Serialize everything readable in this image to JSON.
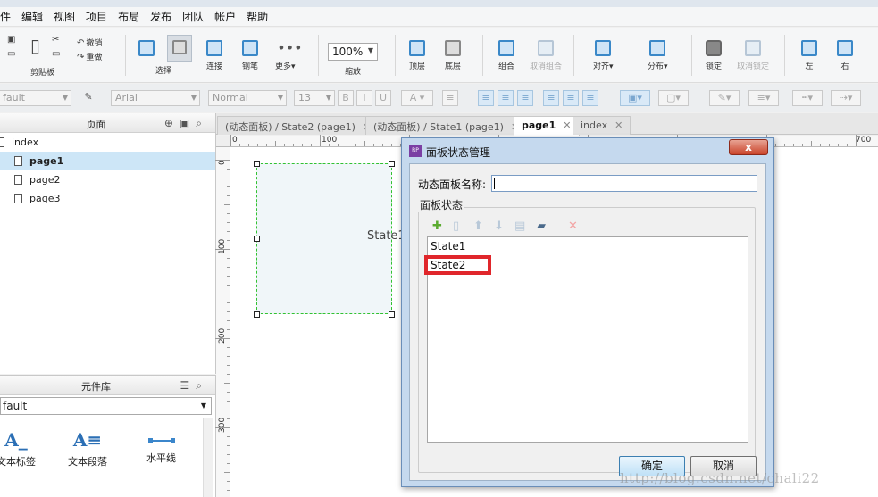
{
  "menubar": {
    "items": [
      "件",
      "编辑",
      "视图",
      "项目",
      "布局",
      "发布",
      "团队",
      "帐户",
      "帮助"
    ]
  },
  "toolbar": {
    "undo": "撤销",
    "redo": "重做",
    "clipboard": "剪贴板",
    "select": "选择",
    "connect": "连接",
    "pen": "钢笔",
    "more": "更多▾",
    "zoom_value": "100%",
    "zoom_label": "缩放",
    "top": "顶层",
    "bottom": "底层",
    "group": "组合",
    "ungroup": "取消组合",
    "align": "对齐▾",
    "distribute": "分布▾",
    "lock": "锁定",
    "unlock": "取消锁定",
    "left": "左",
    "right": "右"
  },
  "formatbar": {
    "style": "fault",
    "font": "Arial",
    "weight": "Normal",
    "size": "13"
  },
  "pages": {
    "title": "页面",
    "items": [
      "index",
      "page1",
      "page2",
      "page3"
    ],
    "selected_index": 1
  },
  "library": {
    "title": "元件库",
    "selected": "fault",
    "widgets": [
      "文本标签",
      "文本段落",
      "水平线"
    ],
    "widget_icons": [
      "A_",
      "A≡"
    ]
  },
  "tabs": [
    {
      "label": "(动态面板) / State2 (page1)"
    },
    {
      "label": "(动态面板) / State1 (page1)"
    },
    {
      "label": "page1"
    },
    {
      "label": "index"
    }
  ],
  "active_tab": 2,
  "ruler": {
    "top": [
      "0",
      "100",
      "700"
    ],
    "left": [
      "0",
      "100",
      "200",
      "300"
    ]
  },
  "canvas": {
    "panel_label": "State1"
  },
  "dialog": {
    "title": "面板状态管理",
    "close_label": "x",
    "name_label": "动态面板名称:",
    "name_value": "",
    "group_label": "面板状态",
    "states": [
      "State1",
      "State2"
    ],
    "ok": "确定",
    "cancel": "取消"
  },
  "watermark": "http://blog.csdn.net/chali22"
}
